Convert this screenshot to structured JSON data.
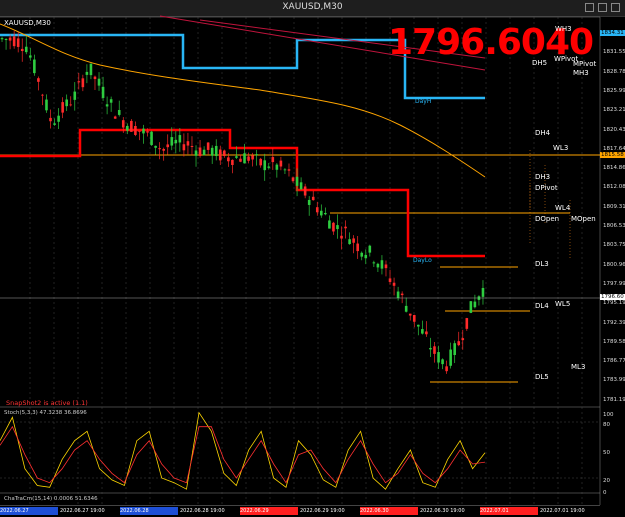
{
  "window": {
    "title": "XAUUSD,M30"
  },
  "chart": {
    "symbol_label": "XAUUSD,M30",
    "current_price": "1796.6040",
    "snapshot_text": "SnapShot2 is active (1.1)",
    "stoch_label": "Stoch(5,3,3) 47.3238 36.8696",
    "bottom_label": "ChaTraCm(15,14) 0.0006 51.6346",
    "y_axis": [
      "1834.31",
      "1831.55",
      "1828.78",
      "1825.99",
      "1823.21",
      "1820.43",
      "1817.64",
      "1814.86",
      "1812.08",
      "1809.31",
      "1806.53",
      "1803.75",
      "1800.96",
      "1797.99",
      "1795.19",
      "1792.39",
      "1789.58",
      "1786.77",
      "1783.99",
      "1781.19"
    ],
    "axis_tags": {
      "top": "1834.31",
      "hline": "1815.58",
      "price": "1796.60"
    },
    "stoch_axis": [
      "100",
      "80",
      "50",
      "20",
      "0"
    ],
    "levels": [
      "WH3",
      "DH5",
      "WPivot",
      "MPivot",
      "MH3",
      "DH4",
      "WL3",
      "DH3",
      "DPivot",
      "WL4",
      "DOpen",
      "MOpen",
      "DL3",
      "DL4",
      "WL5",
      "ML3",
      "DL5",
      "DayH",
      "DayLo"
    ],
    "chart_data": {
      "type": "candlestick",
      "title": "XAUUSD,M30",
      "close_path": [
        1833,
        1833,
        1832,
        1827,
        1821,
        1823,
        1825,
        1829,
        1826,
        1823,
        1821,
        1820,
        1819,
        1817,
        1818,
        1818,
        1817,
        1817,
        1816,
        1816,
        1816,
        1815,
        1815,
        1814,
        1812,
        1810,
        1808,
        1806,
        1805,
        1803,
        1802,
        1800,
        1797,
        1794,
        1791,
        1788,
        1786,
        1789,
        1794,
        1797
      ],
      "stoch_main": [
        60,
        85,
        30,
        12,
        10,
        40,
        60,
        70,
        30,
        18,
        12,
        60,
        70,
        20,
        15,
        8,
        90,
        70,
        25,
        12,
        50,
        70,
        20,
        10,
        60,
        45,
        18,
        10,
        50,
        70,
        20,
        8,
        30,
        50,
        15,
        10,
        40,
        60,
        30,
        47
      ],
      "stoch_signal": [
        55,
        75,
        45,
        20,
        15,
        30,
        50,
        60,
        40,
        25,
        15,
        45,
        60,
        35,
        20,
        15,
        75,
        75,
        40,
        20,
        40,
        60,
        35,
        15,
        45,
        50,
        30,
        15,
        40,
        60,
        35,
        15,
        25,
        45,
        25,
        15,
        30,
        50,
        35,
        37
      ]
    }
  },
  "timebar": [
    {
      "label": "2022.06.27",
      "color": "#1e4fd6"
    },
    {
      "label": "2022.06.27 19:00",
      "color": "#000000"
    },
    {
      "label": "2022.06.28",
      "color": "#1e4fd6"
    },
    {
      "label": "2022.06.28 19:00",
      "color": "#000000"
    },
    {
      "label": "2022.06.29",
      "color": "#ff2020"
    },
    {
      "label": "2022.06.29 19:00",
      "color": "#000000"
    },
    {
      "label": "2022.06.30",
      "color": "#ff2020"
    },
    {
      "label": "2022.06.30 19:00",
      "color": "#000000"
    },
    {
      "label": "2022.07.01",
      "color": "#ff2020"
    },
    {
      "label": "2022.07.01 19:00",
      "color": "#000000"
    }
  ],
  "colors": {
    "big_price": "#ff0000",
    "ma": "#ffa500",
    "range": "#ff0000",
    "week": "#29b6f6",
    "level": "#ff8c1a"
  }
}
